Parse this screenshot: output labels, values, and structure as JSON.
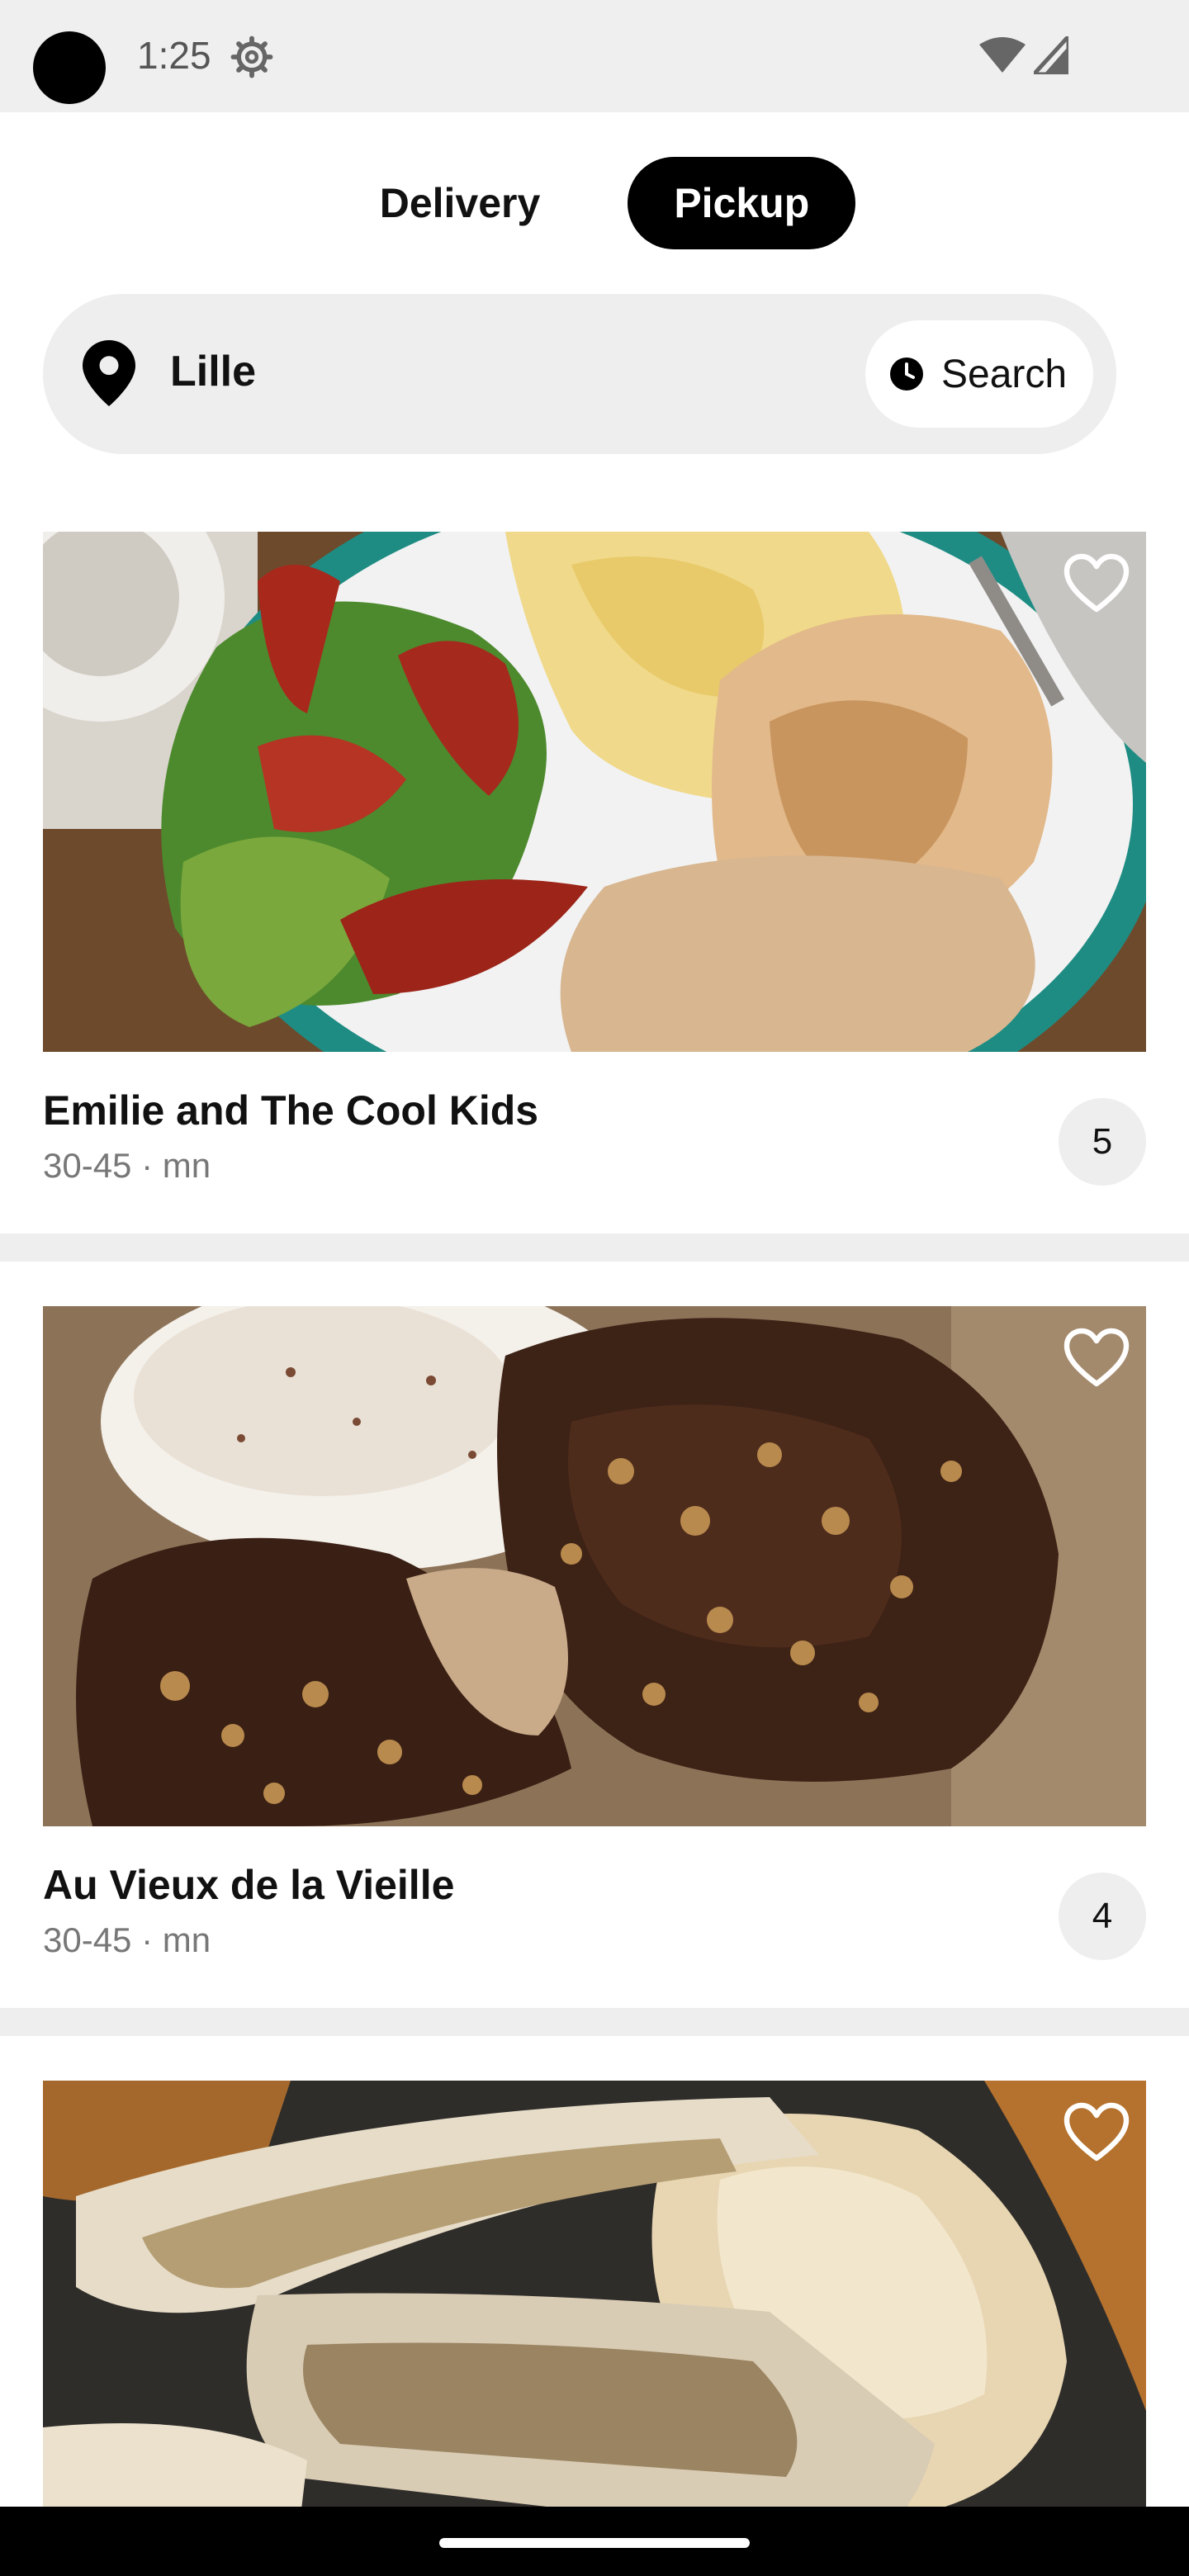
{
  "status_bar": {
    "time": "1:25",
    "icons": [
      "settings-gear-icon",
      "wifi-icon",
      "cell-signal-icon"
    ]
  },
  "mode_toggle": {
    "tabs": [
      {
        "label": "Delivery",
        "active": false
      },
      {
        "label": "Pickup",
        "active": true
      }
    ]
  },
  "search_bar": {
    "location": "Lille",
    "search_label": "Search",
    "location_icon": "map-pin-icon",
    "search_icon": "clock-icon"
  },
  "restaurants": [
    {
      "name": "Emilie and The Cool Kids",
      "time_text": "30-45 · mn",
      "rating": "5",
      "favorite_icon": "heart-outline-icon",
      "image_subject": "salad-eggs-bagel"
    },
    {
      "name": "Au Vieux de la Vieille",
      "time_text": "30-45 · mn",
      "rating": "4",
      "favorite_icon": "heart-outline-icon",
      "image_subject": "chocolate-waffles"
    },
    {
      "favorite_icon": "heart-outline-icon",
      "image_subject": "bone-marrow-toast"
    }
  ],
  "colors": {
    "accent": "#000000",
    "background": "#ffffff",
    "surface": "#eeeeee",
    "muted_text": "#777777"
  }
}
